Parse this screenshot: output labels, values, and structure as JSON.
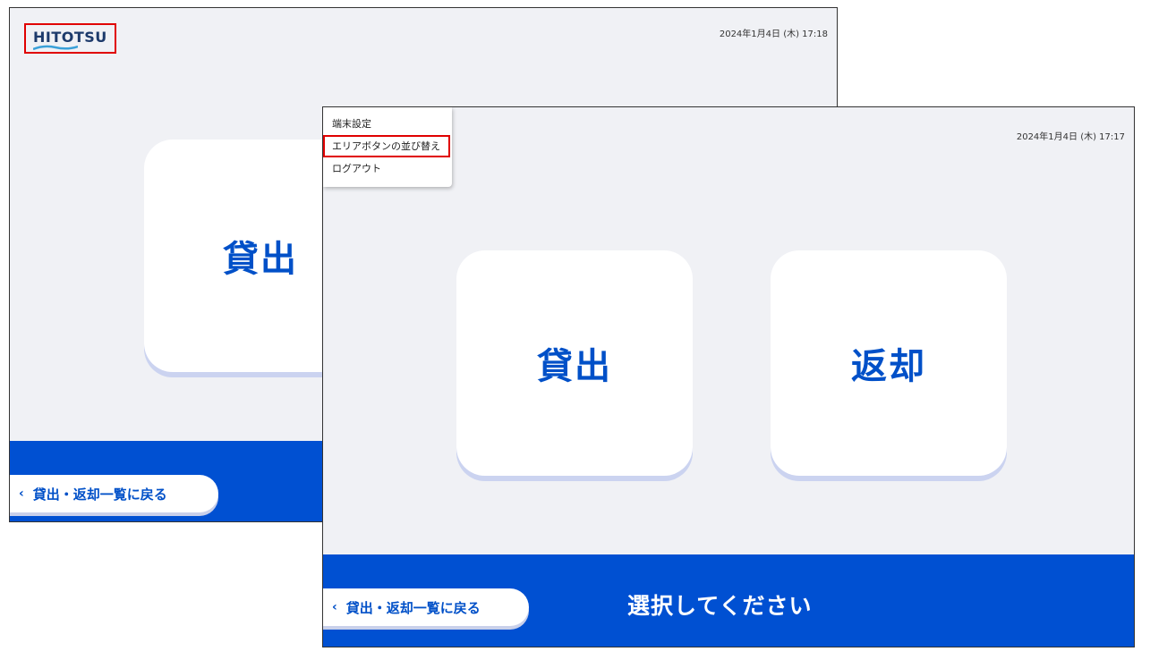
{
  "back_screen": {
    "logo": "HITOTSU",
    "datetime": "2024年1月4日 (木) 17:18",
    "card_lend": "貸出",
    "back_button": "貸出・返却一覧に戻る"
  },
  "front_screen": {
    "datetime": "2024年1月4日 (木) 17:17",
    "menu": {
      "items": [
        {
          "label": "端末設定"
        },
        {
          "label": "エリアボタンの並び替え"
        },
        {
          "label": "ログアウト"
        }
      ]
    },
    "card_lend": "貸出",
    "card_return": "返却",
    "back_button": "貸出・返却一覧に戻る",
    "footer_message": "選択してください"
  },
  "colors": {
    "accent": "#0050d2",
    "highlight_border": "#e00000",
    "background": "#f0f1f5"
  },
  "icons": {
    "back": "chevron-left-icon",
    "logo": "hitotsu-logo"
  }
}
